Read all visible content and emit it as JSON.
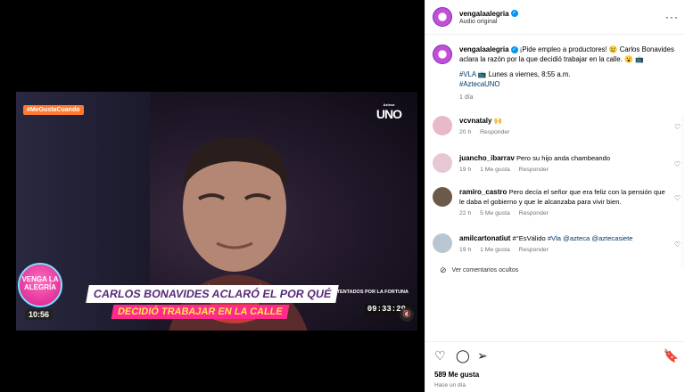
{
  "video": {
    "hashtag": "#MeGustaCuando",
    "channel_logo": "UNO",
    "channel_logo_small": "Azteca",
    "show_logo": "VENGA LA ALEGRÍA",
    "clock": "10:56",
    "headline": "CARLOS BONAVIDES ACLARÓ EL POR QUÉ",
    "subheadline": "DECIDIÓ TRABAJAR EN LA CALLE",
    "fortune_label": "TENTADOS POR LA FORTUNA",
    "fortune_time": "09:33:29",
    "mute_icon": "speaker-muted-icon"
  },
  "header": {
    "username": "vengalaalegria",
    "audio": "Audio original",
    "more_icon": "more-icon"
  },
  "caption": {
    "username": "vengalaalegria",
    "text": "¡Pide empleo a productores! 😢 Carlos Bonavides aclara la razón por la que decidió trabajar en la calle. 😮 📺",
    "hashtag_line_tag": "#VLA",
    "hashtag_line_rest": " 📺 Lunes a viernes, 8:55 a.m.",
    "hashtag2": "#AztecaUNO",
    "time": "1 día"
  },
  "comments": [
    {
      "username": "vcvnataly",
      "text": "🙌",
      "time": "20 h",
      "likes": "",
      "reply": "Responder",
      "avatar_color": "#e8b9c8"
    },
    {
      "username": "juancho_ibarrav",
      "text": "Pero su hijo anda chambeando",
      "time": "19 h",
      "likes": "1 Me gusta",
      "reply": "Responder",
      "avatar_color": "#e7c6d6"
    },
    {
      "username": "ramiro_castro",
      "text": "Pero decía el señor que era feliz con la pensión que le daba el gobierno y que le alcanzaba para vivir bien.",
      "time": "22 h",
      "likes": "5 Me gusta",
      "reply": "Responder",
      "avatar_color": "#6b5a4a"
    },
    {
      "username": "amilcartonatiut",
      "text_plain": "#°EsVálido ",
      "tag1": "#Vla",
      "tag2": "@azteca",
      "tag3": "@aztecasiete",
      "time": "19 h",
      "likes": "1 Me gusta",
      "reply": "Responder",
      "avatar_color": "#b9c6d2"
    }
  ],
  "hidden_comments": "Ver comentarios ocultos",
  "likes": "589 Me gusta",
  "posted": "Hace un día",
  "colors": {
    "link": "#00376b",
    "verified": "#0095f6",
    "muted": "#737373"
  }
}
